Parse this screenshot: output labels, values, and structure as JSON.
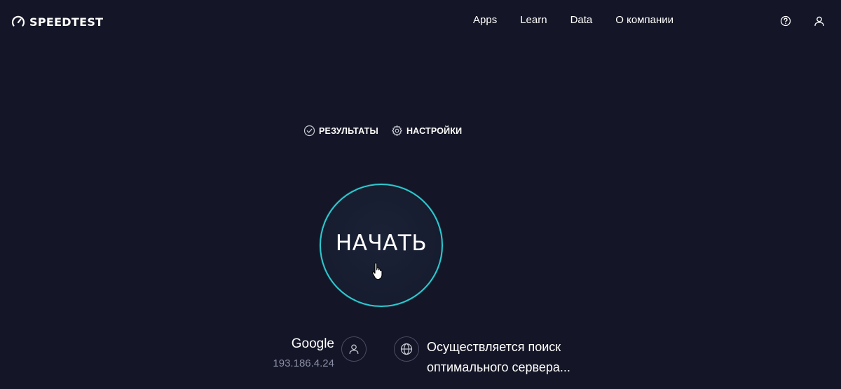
{
  "header": {
    "logo_text": "SPEEDTEST",
    "logo_icon": "speedometer-icon",
    "nav": [
      "Apps",
      "Learn",
      "Data",
      "О компании"
    ],
    "help_icon": "question-circle-icon",
    "user_icon": "user-icon"
  },
  "tabs": [
    {
      "label": "РЕЗУЛЬТАТЫ",
      "icon": "check-circle-icon"
    },
    {
      "label": "НАСТРОЙКИ",
      "icon": "gear-icon"
    }
  ],
  "go_button": {
    "label": "НАЧАТЬ"
  },
  "isp": {
    "name": "Google",
    "ip": "193.186.4.24",
    "icon": "user-icon"
  },
  "server": {
    "line1": "Осуществляется поиск",
    "line2": "оптимального сервера...",
    "icon": "globe-icon"
  },
  "colors": {
    "background": "#141526",
    "accent": "#2ec9cf",
    "muted_text": "#8a8ea6"
  }
}
